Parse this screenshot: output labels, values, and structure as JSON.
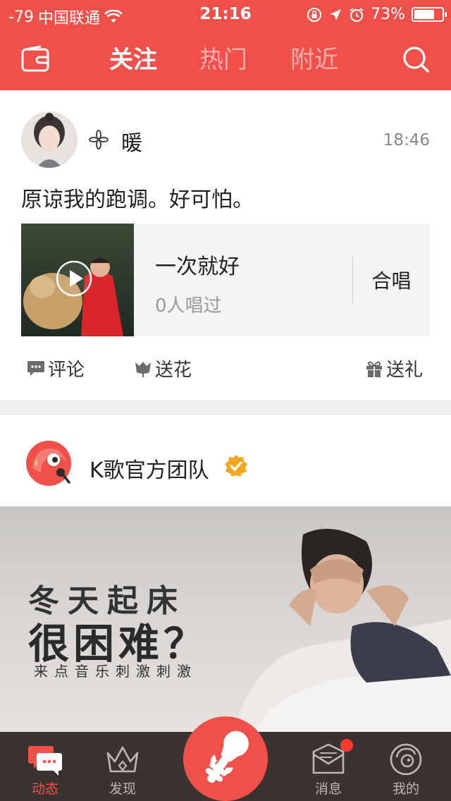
{
  "status_bar": {
    "signal": "-79",
    "carrier": "中国联通",
    "time": "21:16",
    "battery_percent": "73%",
    "battery_level": 0.73
  },
  "top_nav": {
    "tabs": [
      {
        "label": "关注",
        "active": true
      },
      {
        "label": "热门",
        "active": false
      },
      {
        "label": "附近",
        "active": false
      }
    ]
  },
  "post1": {
    "username": "暖",
    "time": "18:46",
    "text": "原谅我的跑调。好可怕。",
    "song": {
      "title": "一次就好",
      "sung_count": "0人唱过",
      "duet_label": "合唱"
    },
    "actions": {
      "comment": "评论",
      "flower": "送花",
      "gift": "送礼"
    }
  },
  "post2": {
    "username": "K歌官方团队",
    "banner": {
      "line1": "冬天起床",
      "line2": "很困难？",
      "line3": "来点音乐刺激刺激"
    }
  },
  "tab_bar": {
    "items": [
      {
        "label": "动态",
        "icon": "feed-icon",
        "active": true
      },
      {
        "label": "发现",
        "icon": "crown-icon",
        "active": false
      },
      {
        "label": "消息",
        "icon": "mail-icon",
        "active": false
      },
      {
        "label": "我的",
        "icon": "profile-icon",
        "active": false
      }
    ]
  },
  "colors": {
    "accent": "#f1504a",
    "tabbar_bg": "#3a3330",
    "verified": "#f5a623"
  }
}
